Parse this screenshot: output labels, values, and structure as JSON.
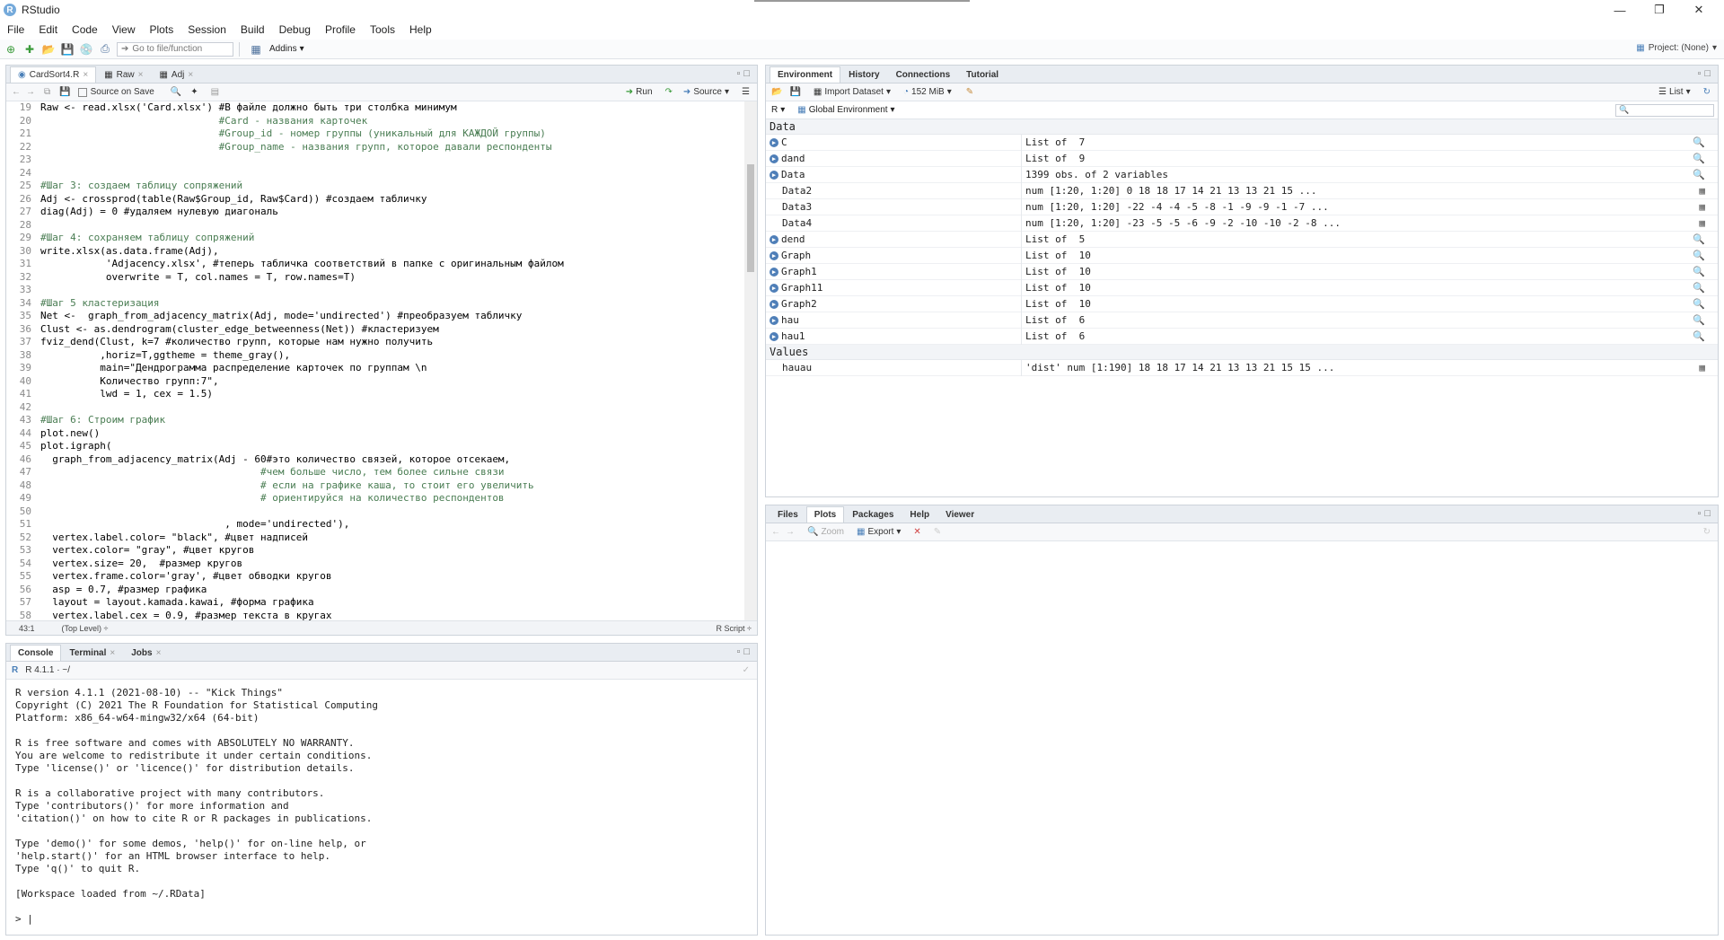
{
  "window": {
    "title": "RStudio",
    "logo": "R",
    "minimize_icon": "minimize-icon",
    "restore_icon": "restore-icon",
    "close_icon": "close-icon"
  },
  "menu": [
    "File",
    "Edit",
    "Code",
    "View",
    "Plots",
    "Session",
    "Build",
    "Debug",
    "Profile",
    "Tools",
    "Help"
  ],
  "toolbar": {
    "goto_placeholder": "Go to file/function",
    "addins": "Addins",
    "project": "Project: (None)"
  },
  "source_pane": {
    "tabs": [
      "CardSort4.R",
      "Raw",
      "Adj"
    ],
    "source_on_save": "Source on Save",
    "run_label": "Run",
    "source_label": "Source",
    "lines": [
      {
        "n": "19",
        "t": "Raw <- read.xlsx('Card.xlsx') #В файле должно быть три столбка минимум"
      },
      {
        "n": "20",
        "t": "                              #Card - названия карточек"
      },
      {
        "n": "21",
        "t": "                              #Group_id - номер группы (уникальный для КАЖДОЙ группы)"
      },
      {
        "n": "22",
        "t": "                              #Group_name - названия групп, которое давали респонденты"
      },
      {
        "n": "23",
        "t": ""
      },
      {
        "n": "24",
        "t": ""
      },
      {
        "n": "25",
        "t": "#Шаг 3: создаем таблицу сопряжений"
      },
      {
        "n": "26",
        "t": "Adj <- crossprod(table(Raw$Group_id, Raw$Card)) #создаем табличку"
      },
      {
        "n": "27",
        "t": "diag(Adj) = 0 #удаляем нулевую диагональ"
      },
      {
        "n": "28",
        "t": ""
      },
      {
        "n": "29",
        "t": "#Шаг 4: сохраняем таблицу сопряжений"
      },
      {
        "n": "30",
        "t": "write.xlsx(as.data.frame(Adj),"
      },
      {
        "n": "31",
        "t": "           'Adjacency.xlsx', #теперь табличка соответствий в папке с оригинальным файлом"
      },
      {
        "n": "32",
        "t": "           overwrite = T, col.names = T, row.names=T)"
      },
      {
        "n": "33",
        "t": ""
      },
      {
        "n": "34",
        "t": "#Шаг 5 кластеризация"
      },
      {
        "n": "35",
        "t": "Net <-  graph_from_adjacency_matrix(Adj, mode='undirected') #преобразуем табличку"
      },
      {
        "n": "36",
        "t": "Clust <- as.dendrogram(cluster_edge_betweenness(Net)) #кластеризуем"
      },
      {
        "n": "37",
        "t": "fviz_dend(Clust, k=7 #количество групп, которые нам нужно получить"
      },
      {
        "n": "38",
        "t": "          ,horiz=T,ggtheme = theme_gray(),"
      },
      {
        "n": "39",
        "t": "          main=\"Дендрограмма распределение карточек по группам \\n"
      },
      {
        "n": "40",
        "t": "          Количество групп:7\","
      },
      {
        "n": "41",
        "t": "          lwd = 1, cex = 1.5)"
      },
      {
        "n": "42",
        "t": ""
      },
      {
        "n": "43",
        "t": "#Шаг 6: Строим график"
      },
      {
        "n": "44",
        "t": "plot.new()"
      },
      {
        "n": "45",
        "t": "plot.igraph("
      },
      {
        "n": "46",
        "t": "  graph_from_adjacency_matrix(Adj - 60#это количество связей, которое отсекаем,"
      },
      {
        "n": "47",
        "t": "                                     #чем больше число, тем более сильне связи"
      },
      {
        "n": "48",
        "t": "                                     # если на графике каша, то стоит его увеличить"
      },
      {
        "n": "49",
        "t": "                                     # ориентируйся на количество респондентов"
      },
      {
        "n": "50",
        "t": ""
      },
      {
        "n": "51",
        "t": "                               , mode='undirected'),"
      },
      {
        "n": "52",
        "t": "  vertex.label.color= \"black\", #цвет надписей"
      },
      {
        "n": "53",
        "t": "  vertex.color= \"gray\", #цвет кругов"
      },
      {
        "n": "54",
        "t": "  vertex.size= 20,  #размер кругов"
      },
      {
        "n": "55",
        "t": "  vertex.frame.color='gray', #цвет обводки кругов"
      },
      {
        "n": "56",
        "t": "  asp = 0.7, #размер графика"
      },
      {
        "n": "57",
        "t": "  layout = layout.kamada.kawai, #форма графика"
      },
      {
        "n": "58",
        "t": "  vertex.label.cex = 0.9, #размер текста в кругах"
      }
    ],
    "status_pos": "43:1",
    "status_level": "(Top Level) ÷",
    "status_type": "R Script ÷"
  },
  "console_pane": {
    "tabs": [
      "Console",
      "Terminal",
      "Jobs"
    ],
    "r_version_path": "R 4.1.1 · ~/",
    "lines": [
      "R version 4.1.1 (2021-08-10) -- \"Kick Things\"",
      "Copyright (C) 2021 The R Foundation for Statistical Computing",
      "Platform: x86_64-w64-mingw32/x64 (64-bit)",
      "",
      "R is free software and comes with ABSOLUTELY NO WARRANTY.",
      "You are welcome to redistribute it under certain conditions.",
      "Type 'license()' or 'licence()' for distribution details.",
      "",
      "R is a collaborative project with many contributors.",
      "Type 'contributors()' for more information and",
      "'citation()' on how to cite R or R packages in publications.",
      "",
      "Type 'demo()' for some demos, 'help()' for on-line help, or",
      "'help.start()' for an HTML browser interface to help.",
      "Type 'q()' to quit R.",
      "",
      "[Workspace loaded from ~/.RData]",
      "",
      "> |"
    ]
  },
  "env_pane": {
    "tabs": [
      "Environment",
      "History",
      "Connections",
      "Tutorial"
    ],
    "import_dataset": "Import Dataset",
    "memory": "152 MiB",
    "list_view": "List",
    "r_selector": "R",
    "global_env": "Global Environment",
    "section_data": "Data",
    "section_values": "Values",
    "data_rows": [
      {
        "name": "C",
        "value": "List of  7",
        "exp": true
      },
      {
        "name": "dand",
        "value": "List of  9",
        "exp": true
      },
      {
        "name": "Data",
        "value": "1399 obs. of 2 variables",
        "exp": true
      },
      {
        "name": "Data2",
        "value": "num [1:20, 1:20] 0 18 18 17 14 21 13 13 21 15 ...",
        "exp": false
      },
      {
        "name": "Data3",
        "value": "num [1:20, 1:20] -22 -4 -4 -5 -8 -1 -9 -9 -1 -7 ...",
        "exp": false
      },
      {
        "name": "Data4",
        "value": "num [1:20, 1:20] -23 -5 -5 -6 -9 -2 -10 -10 -2 -8 ...",
        "exp": false
      },
      {
        "name": "dend",
        "value": "List of  5",
        "exp": true
      },
      {
        "name": "Graph",
        "value": "List of  10",
        "exp": true
      },
      {
        "name": "Graph1",
        "value": "List of  10",
        "exp": true
      },
      {
        "name": "Graph11",
        "value": "List of  10",
        "exp": true
      },
      {
        "name": "Graph2",
        "value": "List of  10",
        "exp": true
      },
      {
        "name": "hau",
        "value": "List of  6",
        "exp": true
      },
      {
        "name": "hau1",
        "value": "List of  6",
        "exp": true
      }
    ],
    "value_rows": [
      {
        "name": "hauau",
        "value": "'dist' num [1:190] 18 18 17 14 21 13 13 21 15 15 ..."
      }
    ]
  },
  "files_pane": {
    "tabs": [
      "Files",
      "Plots",
      "Packages",
      "Help",
      "Viewer"
    ],
    "zoom": "Zoom",
    "export": "Export"
  }
}
